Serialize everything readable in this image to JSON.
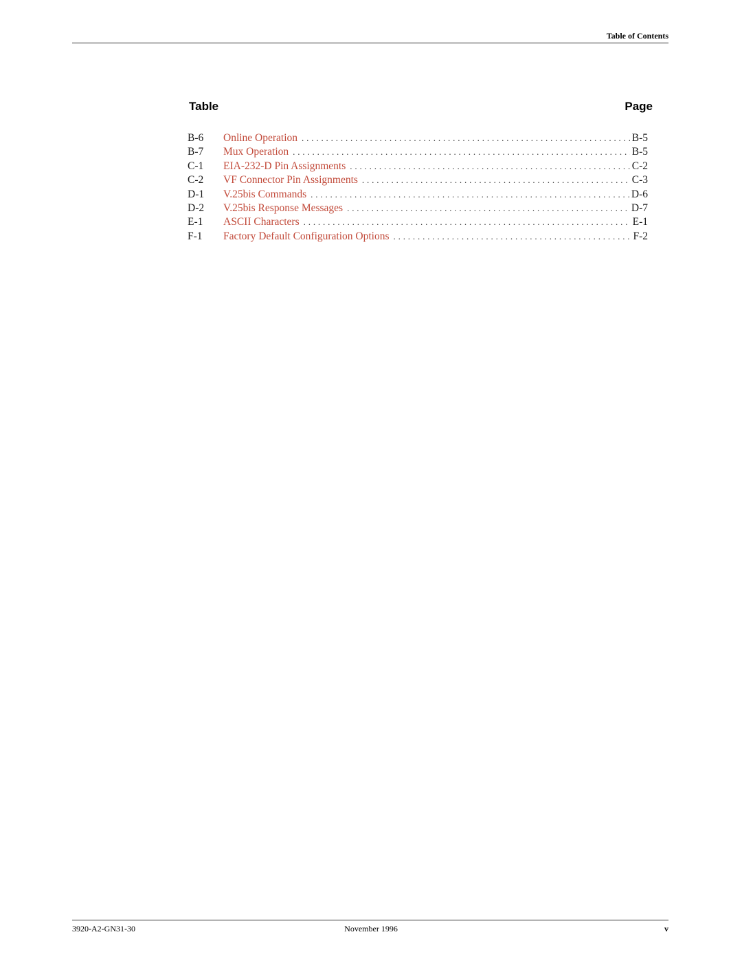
{
  "header": {
    "title": "Table of Contents"
  },
  "columns": {
    "table_label": "Table",
    "page_label": "Page"
  },
  "entries": [
    {
      "number": "B-6",
      "title": "Online Operation",
      "page": "B-5"
    },
    {
      "number": "B-7",
      "title": "Mux Operation",
      "page": "B-5"
    },
    {
      "number": "C-1",
      "title": "EIA-232-D Pin Assignments",
      "page": "C-2"
    },
    {
      "number": "C-2",
      "title": "VF Connector Pin Assignments",
      "page": "C-3"
    },
    {
      "number": "D-1",
      "title": "V.25bis Commands",
      "page": "D-6"
    },
    {
      "number": "D-2",
      "title": "V.25bis Response Messages",
      "page": "D-7"
    },
    {
      "number": "E-1",
      "title": "ASCII Characters",
      "page": "E-1"
    },
    {
      "number": "F-1",
      "title": "Factory Default Configuration Options",
      "page": "F-2"
    }
  ],
  "footer": {
    "doc_number": "3920-A2-GN31-30",
    "date": "November 1996",
    "page_number": "v"
  },
  "colors": {
    "link": "#c24a3a",
    "text": "#1a1a1a"
  }
}
